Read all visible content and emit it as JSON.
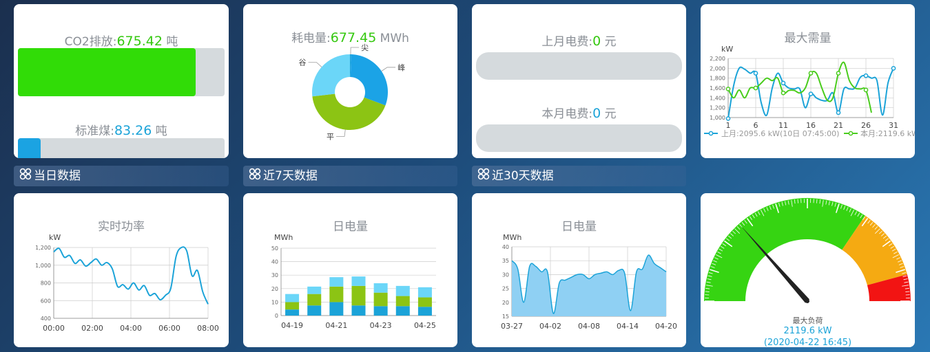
{
  "co2": {
    "label": "CO2排放:",
    "value": "675.42",
    "unit": " 吨",
    "fraction": 0.86
  },
  "coal": {
    "label": "标准煤:",
    "value": "83.26",
    "unit": " 吨",
    "fraction": 0.11
  },
  "consumption": {
    "label": "耗电量:",
    "value": "677.45",
    "unit": " MWh",
    "slices": [
      {
        "name": "尖",
        "value": 0.5
      },
      {
        "name": "峰",
        "value": 27
      },
      {
        "name": "平",
        "value": 38
      },
      {
        "name": "谷",
        "value": 24
      }
    ]
  },
  "fees": {
    "last_label": "上月电费:",
    "last_value": "0",
    "last_unit": " 元",
    "this_label": "本月电费:",
    "this_value": "0",
    "this_unit": " 元"
  },
  "sections": {
    "daily": "当日数据",
    "week": "近7天数据",
    "month": "近30天数据"
  },
  "max_demand": {
    "title": "最大需量",
    "unit": "kW",
    "legend_last": "上月:2095.6 kW(10日 07:45:00)",
    "legend_this": "本月:2119.6 kW",
    "colors": {
      "last": "#1ba3d8",
      "this": "#49cc1c"
    }
  },
  "realtime": {
    "title": "实时功率",
    "unit": "kW"
  },
  "week_energy": {
    "title": "日电量",
    "unit": "MWh"
  },
  "month_energy": {
    "title": "日电量",
    "unit": "MWh"
  },
  "gauge": {
    "label": "最大负荷",
    "value": "2119.6 kW",
    "time": "(2020-04-22 16:45)",
    "fraction": 0.27
  },
  "chart_data": [
    {
      "type": "line",
      "title": "最大需量",
      "ylabel": "kW",
      "ylim": [
        1000,
        2200
      ],
      "x": [
        1,
        2,
        3,
        4,
        5,
        6,
        7,
        8,
        9,
        10,
        11,
        12,
        13,
        14,
        15,
        16,
        17,
        18,
        19,
        20,
        21,
        22,
        23,
        24,
        25,
        26,
        27,
        28,
        29,
        30,
        31
      ],
      "x_ticks": [
        "1",
        "6",
        "11",
        "16",
        "21",
        "26",
        "31"
      ],
      "y_ticks": [
        "1,000",
        "1,200",
        "1,400",
        "1,600",
        "1,800",
        "2,000",
        "2,200"
      ],
      "series": [
        {
          "name": "上月",
          "values": [
            980,
            1650,
            2000,
            1980,
            1900,
            1900,
            1300,
            1050,
            1600,
            1900,
            1700,
            1600,
            1580,
            1580,
            1200,
            1480,
            1400,
            1350,
            1350,
            1500,
            1100,
            1580,
            1580,
            1600,
            1820,
            1850,
            1800,
            1750,
            1050,
            1700,
            2000
          ]
        },
        {
          "name": "本月",
          "values": [
            1580,
            1400,
            1560,
            1400,
            1600,
            1600,
            1700,
            1800,
            1750,
            1800,
            1500,
            1550,
            1550,
            1500,
            1600,
            1900,
            1900,
            1600,
            1350,
            1400,
            1900,
            2120,
            1750,
            1600,
            1580,
            1560,
            1100,
            null,
            null,
            null,
            null
          ]
        }
      ]
    },
    {
      "type": "line",
      "title": "实时功率",
      "ylabel": "kW",
      "ylim": [
        400,
        1200
      ],
      "x_ticks": [
        "00:00",
        "02:00",
        "04:00",
        "06:00",
        "08:00"
      ],
      "y_ticks": [
        "400",
        "600",
        "800",
        "1,000",
        "1,200"
      ],
      "series": [
        {
          "values": [
            1150,
            1190,
            1090,
            1110,
            1020,
            1060,
            990,
            1030,
            1070,
            1000,
            1030,
            960,
            760,
            780,
            730,
            800,
            720,
            770,
            660,
            680,
            610,
            660,
            740,
            1100,
            1200,
            1160,
            880,
            940,
            700,
            560
          ]
        }
      ]
    },
    {
      "type": "bar",
      "title": "日电量",
      "ylabel": "MWh",
      "ylim": [
        0,
        50
      ],
      "categories": [
        "04-19",
        "04-20",
        "04-21",
        "04-22",
        "04-23",
        "04-24",
        "04-25"
      ],
      "x_ticks": [
        "04-19",
        "04-21",
        "04-23",
        "04-25"
      ],
      "y_ticks": [
        "0",
        "10",
        "20",
        "30",
        "40",
        "50"
      ],
      "series": [
        {
          "values": [
            4.5,
            7.5,
            10,
            7.5,
            7,
            7,
            6.5
          ],
          "color": "#1ba3d8"
        },
        {
          "values": [
            5.5,
            8.5,
            11.5,
            14.5,
            10,
            7.5,
            7
          ],
          "color": "#8cc414"
        },
        {
          "values": [
            6,
            5.5,
            7,
            7,
            7,
            7.5,
            7.5
          ],
          "color": "#6bd6f8"
        }
      ]
    },
    {
      "type": "area",
      "title": "日电量",
      "ylabel": "MWh",
      "ylim": [
        15,
        40
      ],
      "x_ticks": [
        "03-27",
        "04-02",
        "04-08",
        "04-14",
        "04-20"
      ],
      "y_ticks": [
        "15",
        "20",
        "25",
        "30",
        "35",
        "40"
      ],
      "series": [
        {
          "values": [
            35,
            32,
            20,
            33,
            33,
            31,
            31,
            16,
            27,
            28,
            29,
            30,
            30,
            28.5,
            30,
            30.5,
            31,
            30,
            31.5,
            30.5,
            17,
            31,
            32,
            37,
            34,
            32.5,
            31
          ]
        }
      ]
    }
  ]
}
